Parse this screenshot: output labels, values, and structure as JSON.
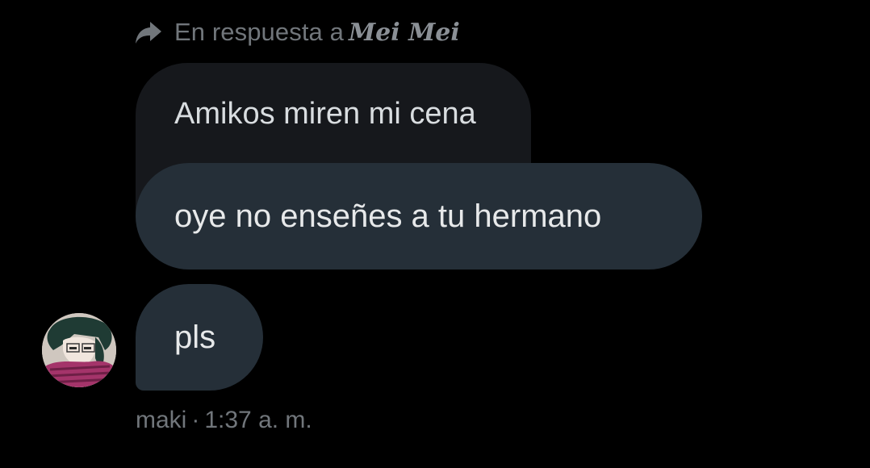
{
  "reply": {
    "label": "En respuesta a",
    "name": "Mei Mei"
  },
  "quoted_message": {
    "text": "Amikos miren mi cena"
  },
  "messages": [
    {
      "text": "oye no enseñes a tu hermano"
    },
    {
      "text": "pls"
    }
  ],
  "sender": {
    "name": "maki",
    "separator": "·",
    "time": "1:37 a. m."
  },
  "colors": {
    "background": "#000000",
    "bubble": "#252f38",
    "quoted_bubble": "#16181c",
    "muted_text": "#71767b"
  }
}
